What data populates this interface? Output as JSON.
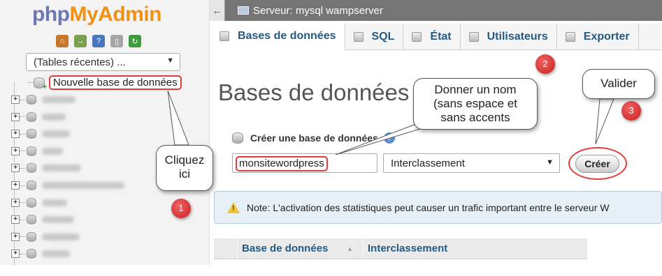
{
  "logo": {
    "php": "php",
    "myadmin": "MyAdmin"
  },
  "quick_icons": [
    {
      "name": "home-icon",
      "color": "#c8762c",
      "glyph": "⌂"
    },
    {
      "name": "exit-icon",
      "color": "#7a9f4f",
      "glyph": "→"
    },
    {
      "name": "help-icon",
      "color": "#4a76c0",
      "glyph": "?"
    },
    {
      "name": "docs-icon",
      "color": "#a5a5a5",
      "glyph": "▯"
    },
    {
      "name": "reload-icon",
      "color": "#3d9a3d",
      "glyph": "↻"
    }
  ],
  "sidebar": {
    "recent_select": "(Tables récentes) ...",
    "new_db_label": "Nouvelle base de données"
  },
  "topbar": {
    "server_label": "Serveur: mysql wampserver",
    "back_glyph": "←"
  },
  "tabs": [
    {
      "label": "Bases de données"
    },
    {
      "label": "SQL"
    },
    {
      "label": "État"
    },
    {
      "label": "Utilisateurs"
    },
    {
      "label": "Exporter"
    }
  ],
  "main": {
    "page_title": "Bases de données",
    "create_label": "Créer une base de données",
    "db_name_value": "monsitewordpress",
    "collation_value": "Interclassement",
    "create_button": "Créer",
    "note": "Note: L'activation des statistiques peut causer un trafic important entre le serveur W",
    "table_headers": [
      "Base de données",
      "Interclassement"
    ]
  },
  "callouts": {
    "click_here": [
      "Cliquez",
      "ici"
    ],
    "give_name": [
      "Donner un nom",
      "(sans espace et",
      "sans accents"
    ],
    "validate": [
      "Valider"
    ]
  },
  "badges": [
    "1",
    "2",
    "3"
  ]
}
